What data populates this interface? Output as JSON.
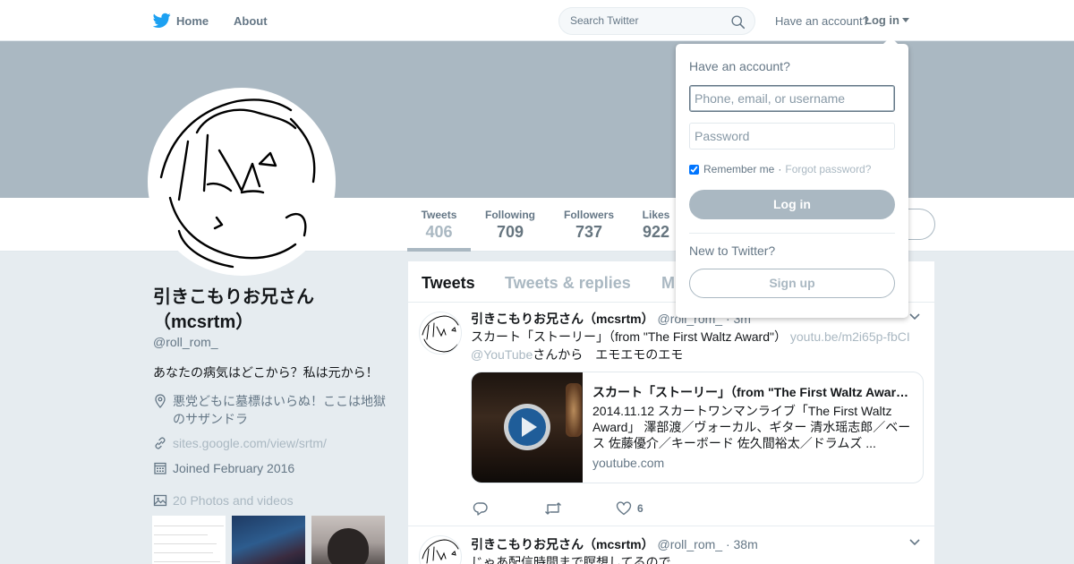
{
  "nav": {
    "home": "Home",
    "about": "About",
    "search_placeholder": "Search Twitter",
    "have_account": "Have an account?",
    "login": "Log in"
  },
  "profile": {
    "name": "引きこもりお兄さん（mcsrtm）",
    "handle": "@roll_rom_",
    "bio": "あなたの病気はどこから？私は元から！",
    "location": "悪党どもに墓標はいらぬ！ここは地獄のサザンドラ",
    "url": "sites.google.com/view/srtm/",
    "joined": "Joined February 2016",
    "photos": "20 Photos and videos"
  },
  "stats": [
    {
      "label": "Tweets",
      "value": "406"
    },
    {
      "label": "Following",
      "value": "709"
    },
    {
      "label": "Followers",
      "value": "737"
    },
    {
      "label": "Likes",
      "value": "922"
    }
  ],
  "timeline": {
    "tabs": [
      "Tweets",
      "Tweets & replies",
      "M"
    ]
  },
  "tweets": [
    {
      "name": "引きこもりお兄さん（mcsrtm）",
      "handle": "@roll_rom_",
      "time": "· 3m",
      "text_main": "スカート「ストーリー」（from \"The First Waltz Award\"）",
      "text_link": "youtu.be/m2i65p-fbCI",
      "text_mention": "@YouTube",
      "text_rest": "さんから　エモエモのエモ",
      "card": {
        "title": "スカート「ストーリー」（from \"The First Waltz Award\"）",
        "desc": "2014.11.12 スカートワンマンライブ「The First Waltz Award」 澤部渡／ヴォーカル、ギター 清水瑶志郎／ベース 佐藤優介／キーボード 佐久間裕太／ドラムズ ...",
        "domain": "youtube.com"
      },
      "likes": "6"
    },
    {
      "name": "引きこもりお兄さん（mcsrtm）",
      "handle": "@roll_rom_",
      "time": "· 38m",
      "text": "じゃあ配信時間まで瞑想してるので"
    }
  ],
  "login_dropdown": {
    "title": "Have an account?",
    "user_placeholder": "Phone, email, or username",
    "password_placeholder": "Password",
    "remember": "Remember me",
    "forgot": "Forgot password?",
    "login_button": "Log in",
    "new_to": "New to Twitter?",
    "signup_button": "Sign up"
  },
  "colors": {
    "accent_muted": "#aab8c2",
    "brand_blue": "#1da1f2",
    "text_secondary": "#657786"
  }
}
